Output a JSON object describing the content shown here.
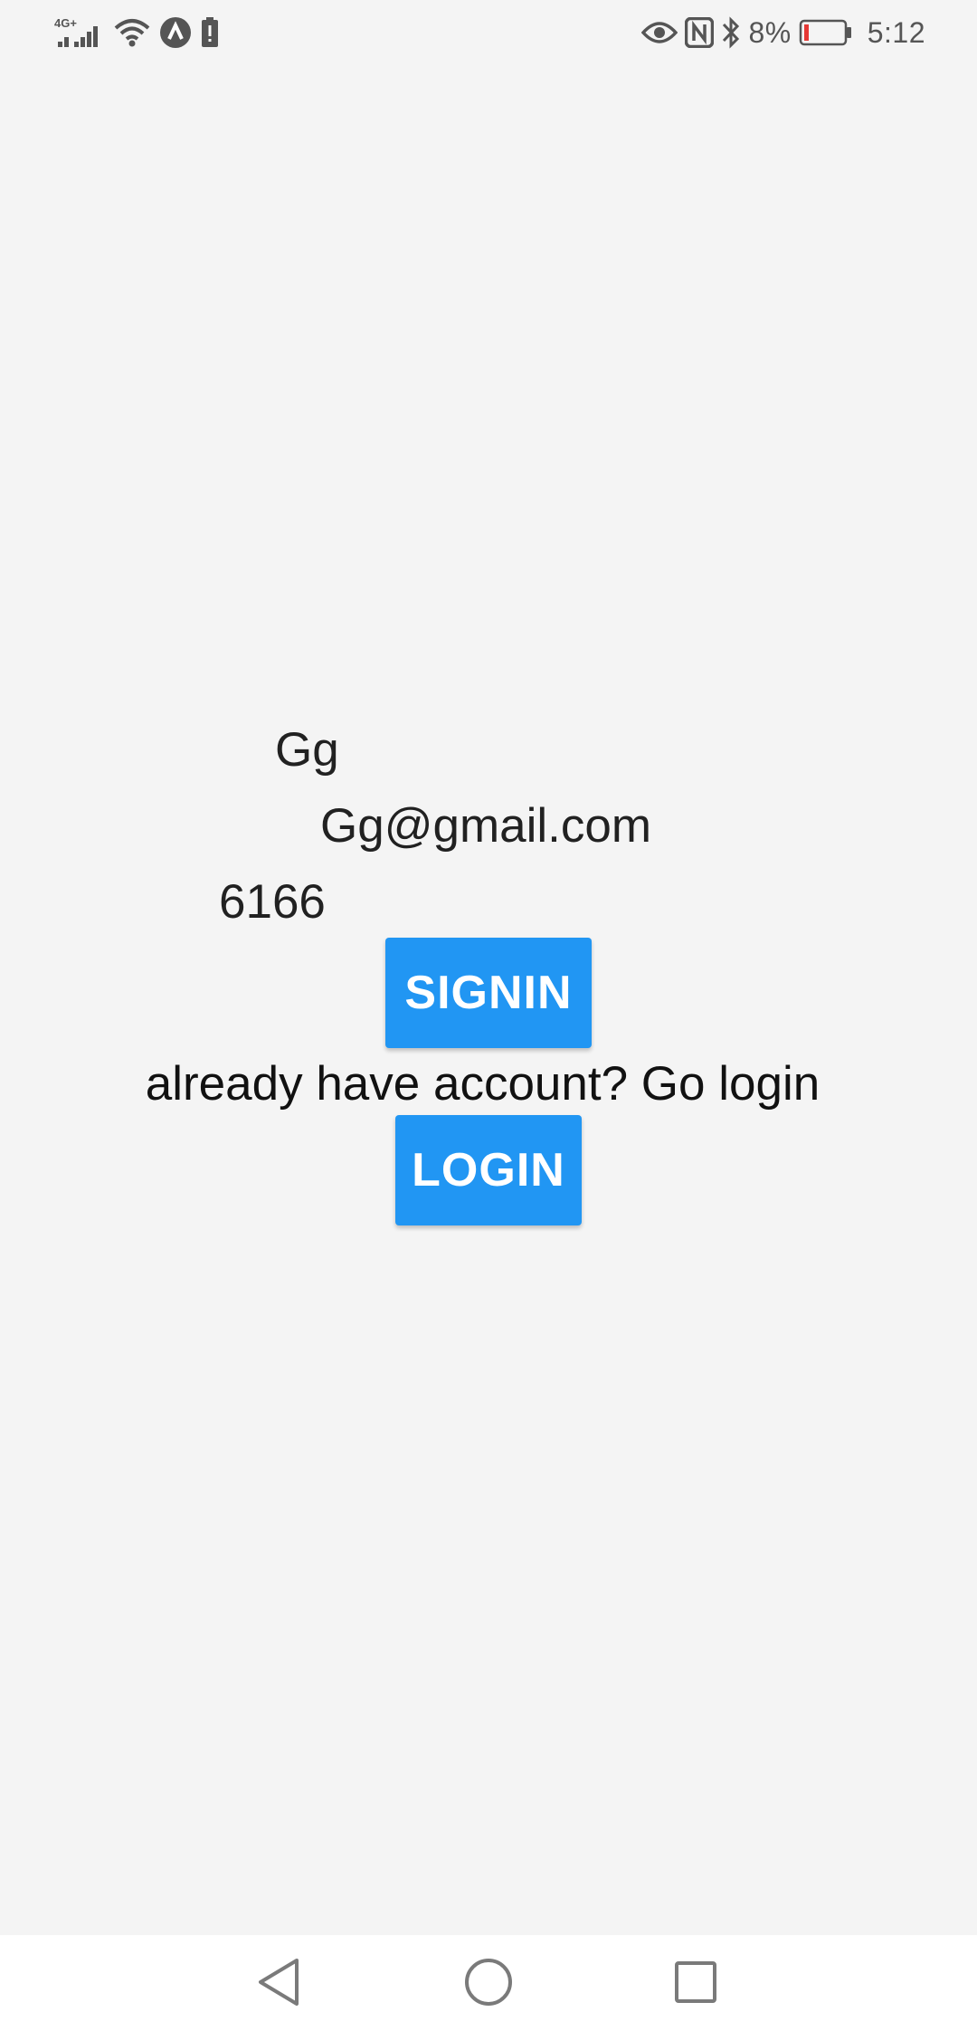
{
  "status_bar": {
    "network_label": "4G+",
    "battery_percent": "8%",
    "time": "5:12",
    "left_icons": [
      "signal-icon",
      "wifi-icon",
      "app-notification-icon",
      "battery-alert-icon"
    ],
    "right_icons": [
      "eye-icon",
      "nfc-icon",
      "bluetooth-icon",
      "battery-icon"
    ],
    "battery_low_color": "#e53935"
  },
  "form": {
    "name_value": "Gg",
    "email_value": "Gg@gmail.com",
    "password_value": "6166",
    "signin_label": "SIGNIN",
    "prompt_text": "already have account? Go login",
    "login_label": "LOGIN"
  },
  "colors": {
    "background": "#f4f4f4",
    "button": "#2196f3",
    "button_text": "#ffffff"
  },
  "nav_bar": {
    "icons": [
      "back-icon",
      "home-icon",
      "recent-apps-icon"
    ]
  }
}
